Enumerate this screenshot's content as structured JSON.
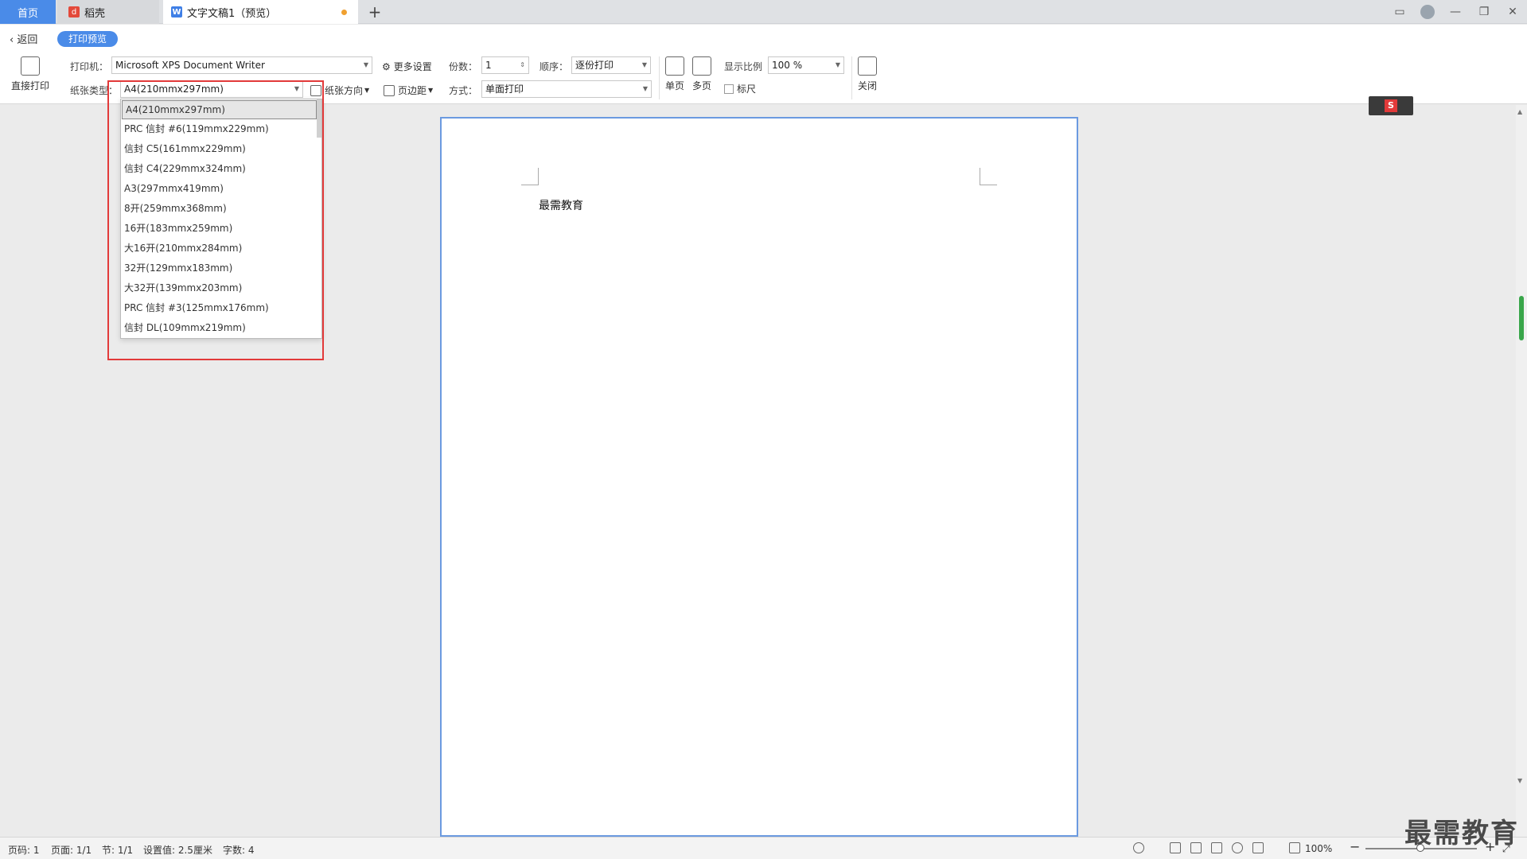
{
  "tabs": {
    "home": "首页",
    "daoke": "稻壳",
    "document": "文字文稿1（预览）"
  },
  "nav": {
    "back": "返回",
    "mode": "打印预览"
  },
  "toolbar": {
    "direct_print": "直接打印",
    "printer_label": "打印机：",
    "printer_value": "Microsoft XPS Document Writer",
    "more_settings": "更多设置",
    "copies_label": "份数：",
    "copies_value": "1",
    "order_label": "顺序：",
    "order_value": "逐份打印",
    "paper_type_label": "纸张类型：",
    "paper_type_value": "A4(210mmx297mm)",
    "orientation": "纸张方向",
    "margins": "页边距",
    "mode_label": "方式：",
    "mode_value": "单面打印",
    "single_page": "单页",
    "multi_page": "多页",
    "zoom_label": "显示比例",
    "zoom_value": "100 %",
    "ruler": "标尺",
    "close": "关闭"
  },
  "paper_options": [
    "A4(210mmx297mm)",
    "PRC 信封 #6(119mmx229mm)",
    "信封 C5(161mmx229mm)",
    "信封 C4(229mmx324mm)",
    "A3(297mmx419mm)",
    "8开(259mmx368mm)",
    "16开(183mmx259mm)",
    "大16开(210mmx284mm)",
    "32开(129mmx183mm)",
    "大32开(139mmx203mm)",
    "PRC 信封 #3(125mmx176mm)",
    "信封 DL(109mmx219mm)"
  ],
  "document": {
    "body_text": "最需教育"
  },
  "status": {
    "page_code": "页码: 1",
    "pages": "页面: 1/1",
    "section": "节: 1/1",
    "setting": "设置值: 2.5厘米",
    "word_count": "字数: 4",
    "zoom": "100%"
  },
  "watermark": "最需教育",
  "colors": {
    "accent": "#4a8be8",
    "highlight": "#e23a3a",
    "page_border": "#6b9ae0"
  }
}
